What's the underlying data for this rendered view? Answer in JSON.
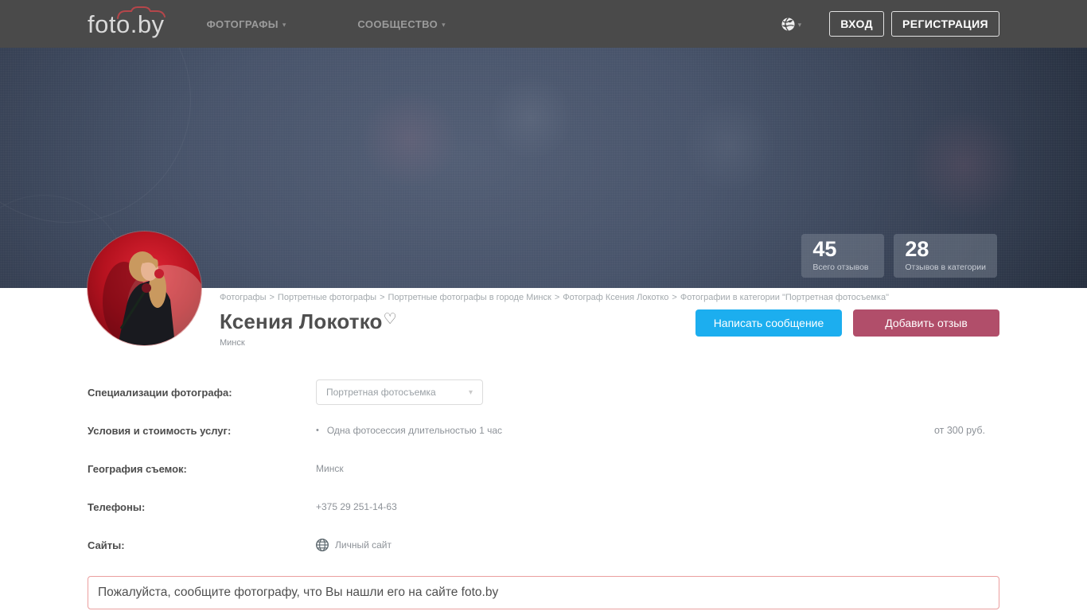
{
  "navbar": {
    "logo": "foto.by",
    "items": [
      {
        "label": "ФОТОГРАФЫ"
      },
      {
        "label": "СООБЩЕСТВО"
      }
    ],
    "login_label": "ВХОД",
    "register_label": "РЕГИСТРАЦИЯ"
  },
  "hero": {
    "stats": [
      {
        "value": "45",
        "label": "Всего отзывов"
      },
      {
        "value": "28",
        "label": "Отзывов в категории"
      }
    ]
  },
  "breadcrumb": {
    "separator": ">",
    "items": [
      {
        "label": "Фотографы"
      },
      {
        "label": "Портретные фотографы"
      },
      {
        "label": "Портретные фотографы в городе Минск"
      },
      {
        "label": "Фотограф Ксения Локотко"
      },
      {
        "label": "Фотографии в категории \"Портретная фотосъемка\""
      }
    ]
  },
  "profile": {
    "name": "Ксения Локотко",
    "city": "Минск",
    "message_button": "Написать сообщение",
    "review_button": "Добавить отзыв"
  },
  "details": {
    "specializations_label": "Специализации фотографа:",
    "specialization_selected": "Портретная фотосъемка",
    "pricing_label": "Условия и стоимость услуг:",
    "pricing_item": "Одна фотосессия длительностью 1 час",
    "pricing_value": "от 300 руб.",
    "geography_label": "География съемок:",
    "geography_value": "Минск",
    "phones_label": "Телефоны:",
    "phones_value": "+375 29 251-14-63",
    "sites_label": "Сайты:",
    "sites_value": "Личный сайт"
  },
  "notice": "Пожалуйста, сообщите фотографу, что Вы нашли его на сайте foto.by",
  "icons": {
    "dropdown_caret": "▾",
    "favorite_heart": "♡",
    "bullet": "•"
  },
  "colors": {
    "navbar_bg": "#4a4a4a",
    "logo_camera_red": "#b5464a",
    "hero_base": "#414d63",
    "message_button_blue": "#1caeef",
    "review_button_maroon": "#b14e6a",
    "notice_border_pink": "#eb9f9f"
  }
}
